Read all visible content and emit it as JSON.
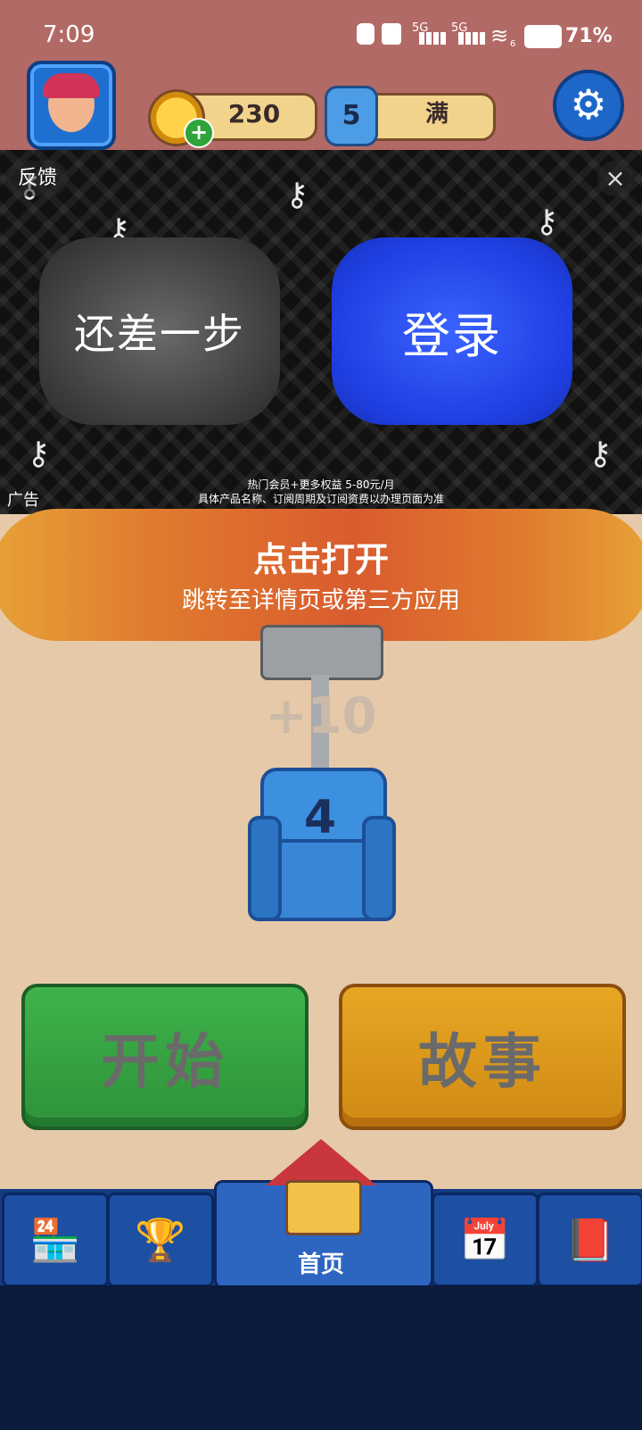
{
  "status_bar": {
    "time": "7:09",
    "icons": [
      "face-icon",
      "notification-icon",
      "signal-5g-1-icon",
      "signal-5g-2-icon",
      "wifi-icon"
    ],
    "signal_1_label": "5G",
    "signal_2_label": "5G",
    "wifi_badge": "6",
    "battery": "71%"
  },
  "header": {
    "coins": "230",
    "lives_count": "5",
    "lives_status": "满"
  },
  "ad": {
    "feedback": "反馈",
    "close": "×",
    "left_button": "还差一步",
    "right_button": "登录",
    "disclaimer_line1": "热门会员+更多权益 5-80元/月",
    "disclaimer_line2": "具体产品名称、订阅周期及订阅资费以办理页面为准",
    "label": "广告"
  },
  "banner": {
    "title": "点击打开",
    "subtitle": "跳转至详情页或第三方应用"
  },
  "progress": {
    "reward": "+10",
    "seat_number": "4"
  },
  "actions": {
    "start": "开始",
    "story": "故事"
  },
  "nav": {
    "home_label": "首页",
    "icons": [
      "shop-icon",
      "trophy-icon",
      "home-icon",
      "calendar-icon",
      "book-icon"
    ]
  },
  "colors": {
    "top_band": "#b26a66",
    "banner_orange": "#d95c2f",
    "start_green": "#3fb34a",
    "story_gold": "#e7a724",
    "nav_blue": "#1d4fa3"
  }
}
